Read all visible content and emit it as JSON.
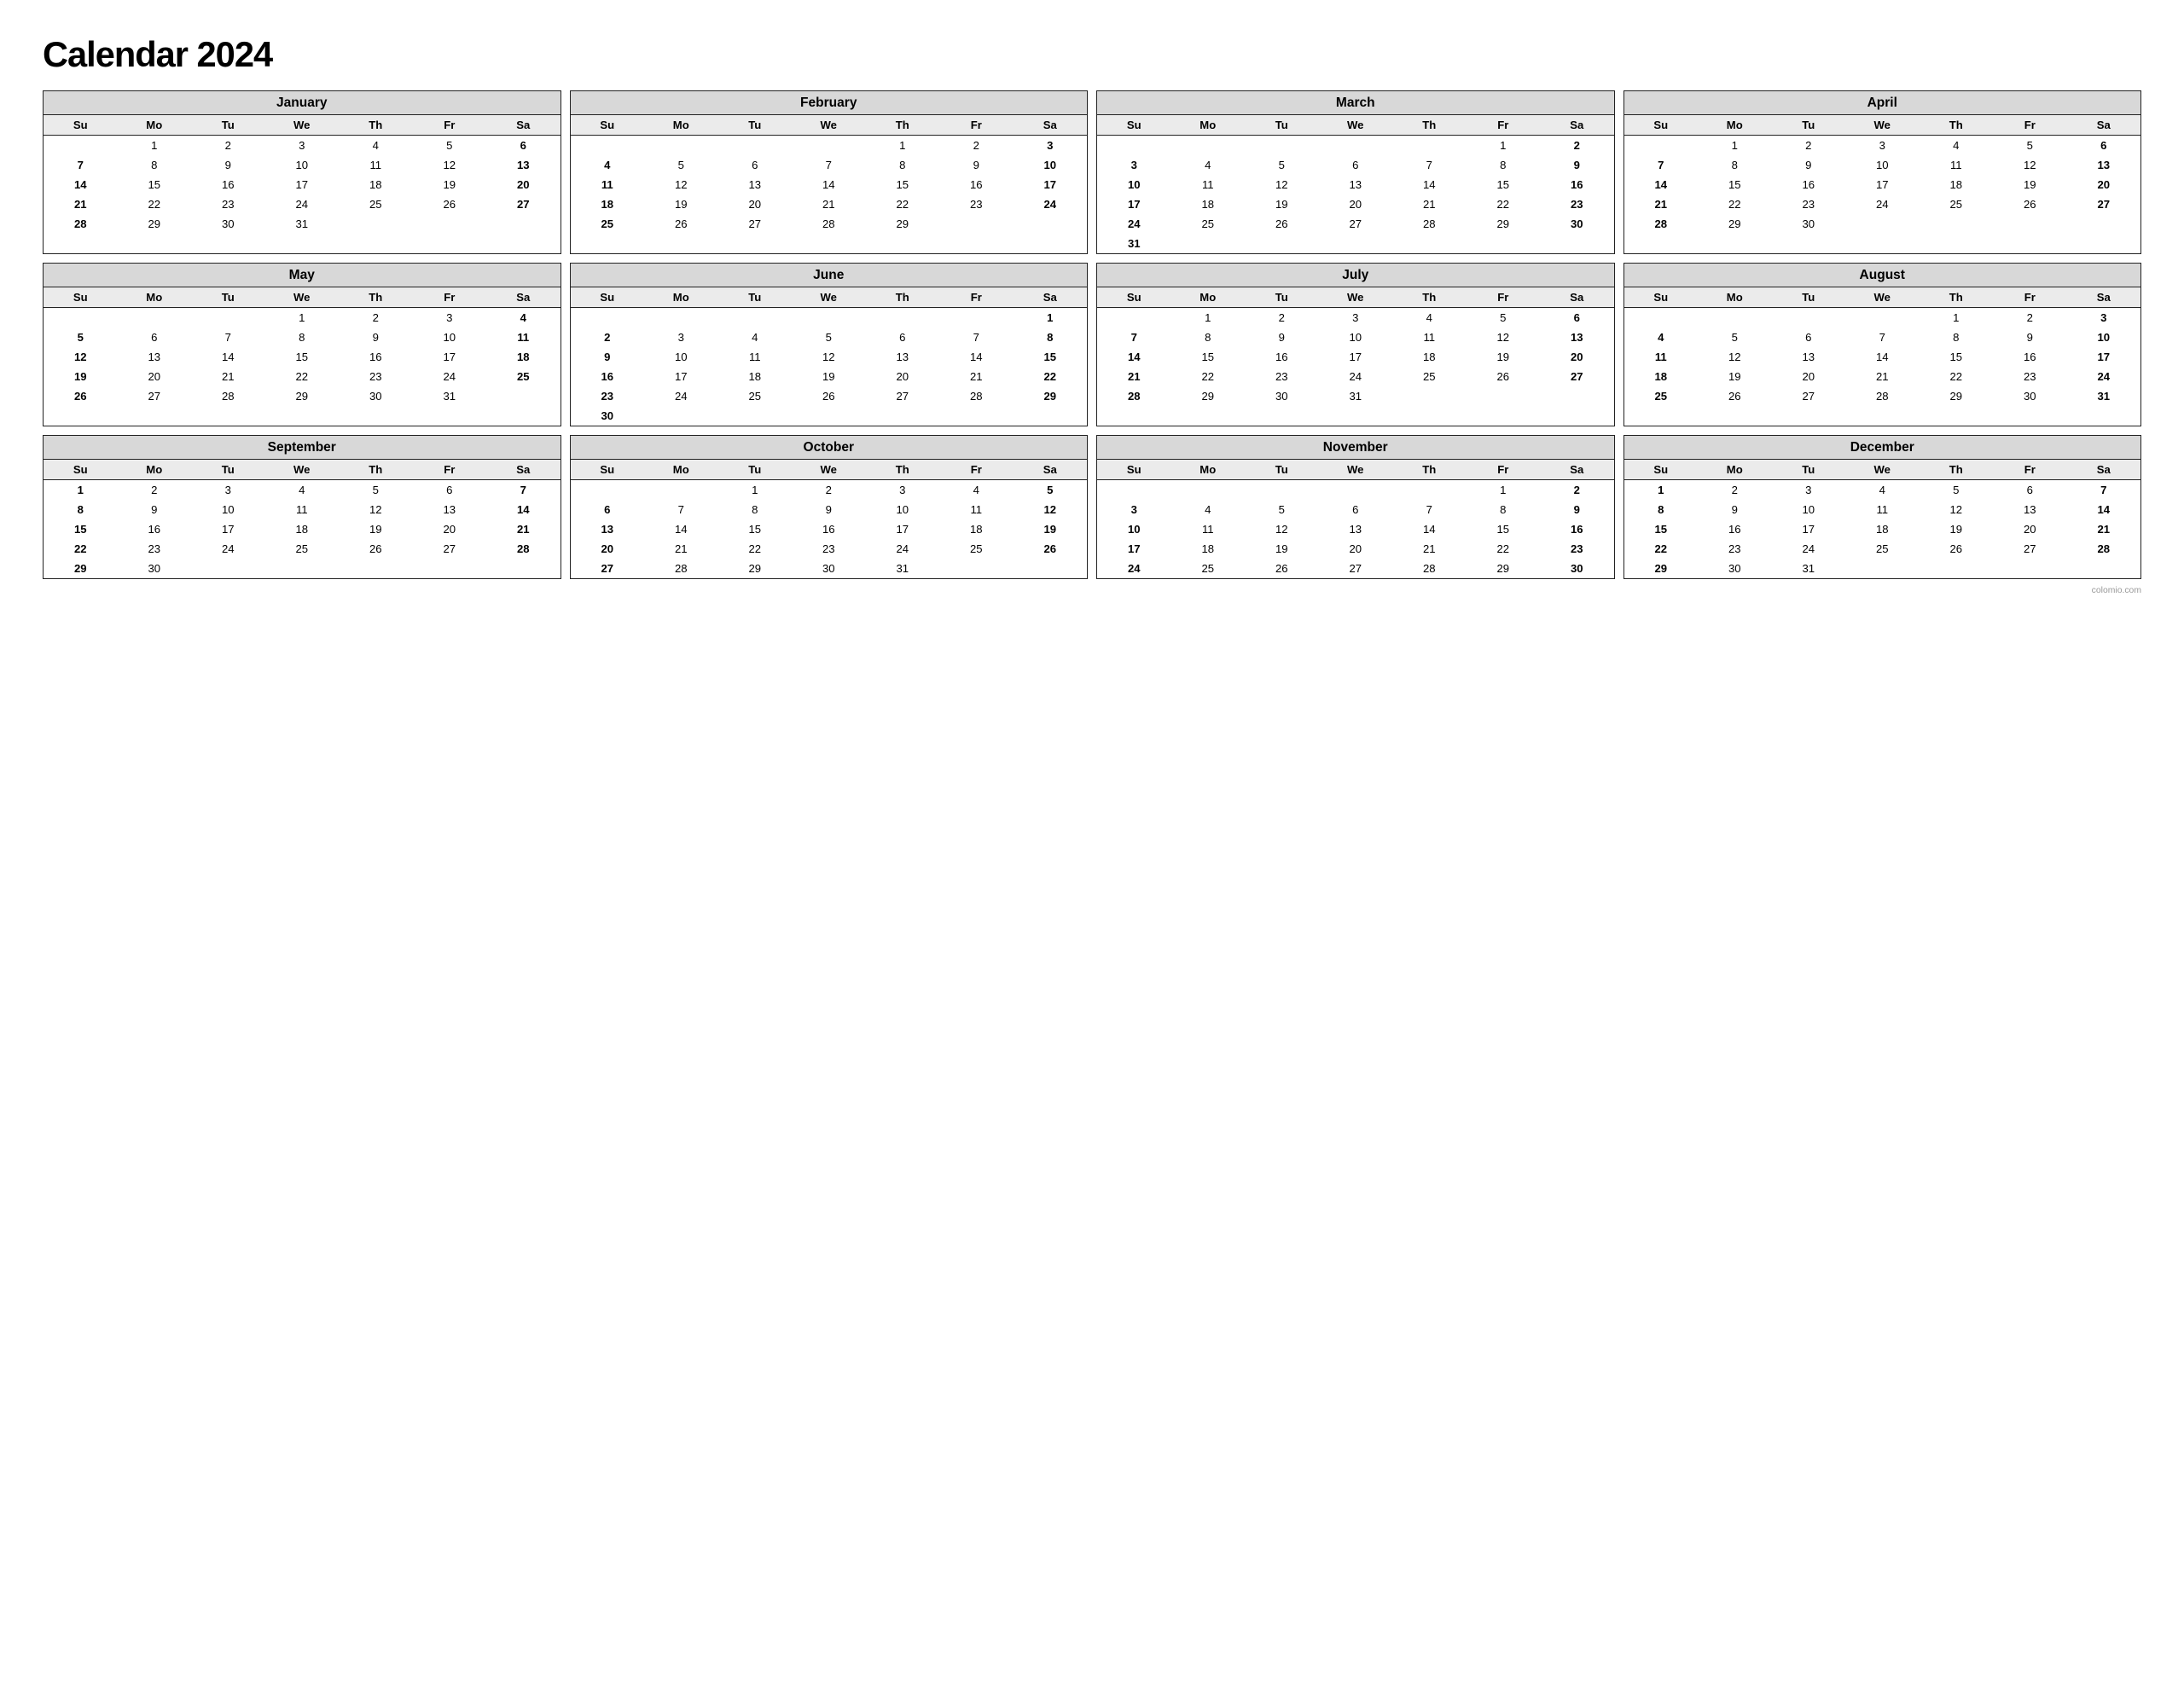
{
  "title": "Calendar 2024",
  "footer": "colomio.com",
  "days_header": [
    "Su",
    "Mo",
    "Tu",
    "We",
    "Th",
    "Fr",
    "Sa"
  ],
  "months": [
    {
      "name": "January",
      "weeks": [
        [
          "",
          "1",
          "2",
          "3",
          "4",
          "5",
          "6"
        ],
        [
          "7",
          "8",
          "9",
          "10",
          "11",
          "12",
          "13"
        ],
        [
          "14",
          "15",
          "16",
          "17",
          "18",
          "19",
          "20"
        ],
        [
          "21",
          "22",
          "23",
          "24",
          "25",
          "26",
          "27"
        ],
        [
          "28",
          "29",
          "30",
          "31",
          "",
          "",
          ""
        ]
      ]
    },
    {
      "name": "February",
      "weeks": [
        [
          "",
          "",
          "",
          "",
          "1",
          "2",
          "3"
        ],
        [
          "4",
          "5",
          "6",
          "7",
          "8",
          "9",
          "10"
        ],
        [
          "11",
          "12",
          "13",
          "14",
          "15",
          "16",
          "17"
        ],
        [
          "18",
          "19",
          "20",
          "21",
          "22",
          "23",
          "24"
        ],
        [
          "25",
          "26",
          "27",
          "28",
          "29",
          "",
          ""
        ]
      ]
    },
    {
      "name": "March",
      "weeks": [
        [
          "",
          "",
          "",
          "",
          "",
          "1",
          "2"
        ],
        [
          "3",
          "4",
          "5",
          "6",
          "7",
          "8",
          "9"
        ],
        [
          "10",
          "11",
          "12",
          "13",
          "14",
          "15",
          "16"
        ],
        [
          "17",
          "18",
          "19",
          "20",
          "21",
          "22",
          "23"
        ],
        [
          "24",
          "25",
          "26",
          "27",
          "28",
          "29",
          "30"
        ],
        [
          "31",
          "",
          "",
          "",
          "",
          "",
          ""
        ]
      ]
    },
    {
      "name": "April",
      "weeks": [
        [
          "",
          "1",
          "2",
          "3",
          "4",
          "5",
          "6"
        ],
        [
          "7",
          "8",
          "9",
          "10",
          "11",
          "12",
          "13"
        ],
        [
          "14",
          "15",
          "16",
          "17",
          "18",
          "19",
          "20"
        ],
        [
          "21",
          "22",
          "23",
          "24",
          "25",
          "26",
          "27"
        ],
        [
          "28",
          "29",
          "30",
          "",
          "",
          "",
          ""
        ]
      ]
    },
    {
      "name": "May",
      "weeks": [
        [
          "",
          "",
          "",
          "1",
          "2",
          "3",
          "4"
        ],
        [
          "5",
          "6",
          "7",
          "8",
          "9",
          "10",
          "11"
        ],
        [
          "12",
          "13",
          "14",
          "15",
          "16",
          "17",
          "18"
        ],
        [
          "19",
          "20",
          "21",
          "22",
          "23",
          "24",
          "25"
        ],
        [
          "26",
          "27",
          "28",
          "29",
          "30",
          "31",
          ""
        ]
      ]
    },
    {
      "name": "June",
      "weeks": [
        [
          "",
          "",
          "",
          "",
          "",
          "",
          "1"
        ],
        [
          "2",
          "3",
          "4",
          "5",
          "6",
          "7",
          "8"
        ],
        [
          "9",
          "10",
          "11",
          "12",
          "13",
          "14",
          "15"
        ],
        [
          "16",
          "17",
          "18",
          "19",
          "20",
          "21",
          "22"
        ],
        [
          "23",
          "24",
          "25",
          "26",
          "27",
          "28",
          "29"
        ],
        [
          "30",
          "",
          "",
          "",
          "",
          "",
          ""
        ]
      ]
    },
    {
      "name": "July",
      "weeks": [
        [
          "",
          "1",
          "2",
          "3",
          "4",
          "5",
          "6"
        ],
        [
          "7",
          "8",
          "9",
          "10",
          "11",
          "12",
          "13"
        ],
        [
          "14",
          "15",
          "16",
          "17",
          "18",
          "19",
          "20"
        ],
        [
          "21",
          "22",
          "23",
          "24",
          "25",
          "26",
          "27"
        ],
        [
          "28",
          "29",
          "30",
          "31",
          "",
          "",
          ""
        ]
      ]
    },
    {
      "name": "August",
      "weeks": [
        [
          "",
          "",
          "",
          "",
          "1",
          "2",
          "3"
        ],
        [
          "4",
          "5",
          "6",
          "7",
          "8",
          "9",
          "10"
        ],
        [
          "11",
          "12",
          "13",
          "14",
          "15",
          "16",
          "17"
        ],
        [
          "18",
          "19",
          "20",
          "21",
          "22",
          "23",
          "24"
        ],
        [
          "25",
          "26",
          "27",
          "28",
          "29",
          "30",
          "31"
        ]
      ]
    },
    {
      "name": "September",
      "weeks": [
        [
          "1",
          "2",
          "3",
          "4",
          "5",
          "6",
          "7"
        ],
        [
          "8",
          "9",
          "10",
          "11",
          "12",
          "13",
          "14"
        ],
        [
          "15",
          "16",
          "17",
          "18",
          "19",
          "20",
          "21"
        ],
        [
          "22",
          "23",
          "24",
          "25",
          "26",
          "27",
          "28"
        ],
        [
          "29",
          "30",
          "",
          "",
          "",
          "",
          ""
        ]
      ]
    },
    {
      "name": "October",
      "weeks": [
        [
          "",
          "",
          "1",
          "2",
          "3",
          "4",
          "5"
        ],
        [
          "6",
          "7",
          "8",
          "9",
          "10",
          "11",
          "12"
        ],
        [
          "13",
          "14",
          "15",
          "16",
          "17",
          "18",
          "19"
        ],
        [
          "20",
          "21",
          "22",
          "23",
          "24",
          "25",
          "26"
        ],
        [
          "27",
          "28",
          "29",
          "30",
          "31",
          "",
          ""
        ]
      ]
    },
    {
      "name": "November",
      "weeks": [
        [
          "",
          "",
          "",
          "",
          "",
          "1",
          "2"
        ],
        [
          "3",
          "4",
          "5",
          "6",
          "7",
          "8",
          "9"
        ],
        [
          "10",
          "11",
          "12",
          "13",
          "14",
          "15",
          "16"
        ],
        [
          "17",
          "18",
          "19",
          "20",
          "21",
          "22",
          "23"
        ],
        [
          "24",
          "25",
          "26",
          "27",
          "28",
          "29",
          "30"
        ]
      ]
    },
    {
      "name": "December",
      "weeks": [
        [
          "1",
          "2",
          "3",
          "4",
          "5",
          "6",
          "7"
        ],
        [
          "8",
          "9",
          "10",
          "11",
          "12",
          "13",
          "14"
        ],
        [
          "15",
          "16",
          "17",
          "18",
          "19",
          "20",
          "21"
        ],
        [
          "22",
          "23",
          "24",
          "25",
          "26",
          "27",
          "28"
        ],
        [
          "29",
          "30",
          "31",
          "",
          "",
          "",
          ""
        ]
      ]
    }
  ]
}
